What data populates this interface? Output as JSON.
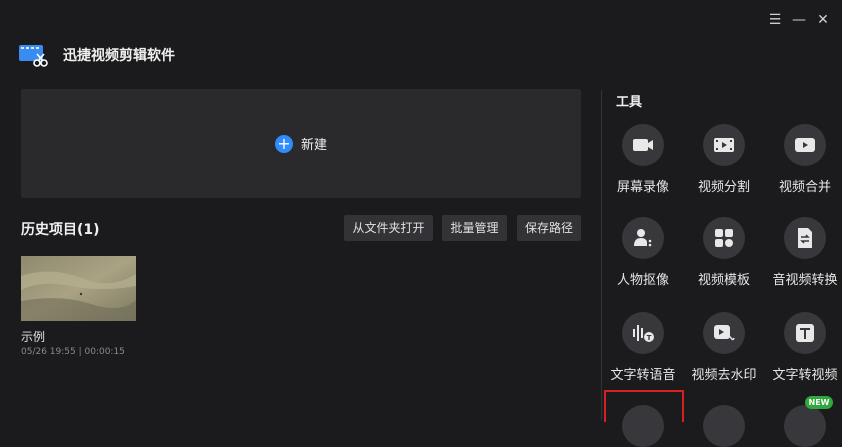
{
  "app": {
    "title": "迅捷视频剪辑软件"
  },
  "window_controls": {
    "menu": "☰",
    "minimize": "—",
    "close": "✕"
  },
  "new_project": {
    "label": "新建",
    "icon": "plus-circle-icon",
    "accent": "#2f8cff"
  },
  "history": {
    "title": "历史项目(1)",
    "buttons": {
      "open_folder": "从文件夹打开",
      "batch_manage": "批量管理",
      "save_path": "保存路径"
    },
    "projects": [
      {
        "name": "示例",
        "meta": "05/26 19:55 | 00:00:15"
      }
    ]
  },
  "tools": {
    "title": "工具",
    "items": [
      {
        "label": "屏幕录像",
        "icon": "screen-record-icon"
      },
      {
        "label": "视频分割",
        "icon": "film-split-icon"
      },
      {
        "label": "视频合并",
        "icon": "video-merge-icon"
      },
      {
        "label": "人物抠像",
        "icon": "person-cutout-icon"
      },
      {
        "label": "视频模板",
        "icon": "template-icon"
      },
      {
        "label": "音视频转换",
        "icon": "convert-icon"
      },
      {
        "label": "文字转语音",
        "icon": "text-to-speech-icon"
      },
      {
        "label": "视频去水印",
        "icon": "remove-watermark-icon"
      },
      {
        "label": "文字转视频",
        "icon": "text-to-video-icon"
      }
    ],
    "badge": "NEW"
  }
}
